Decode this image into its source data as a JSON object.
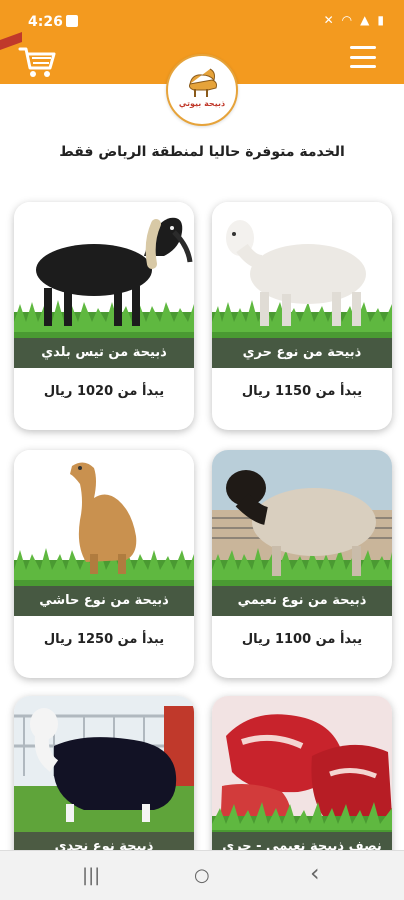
{
  "status": {
    "time": "4:26"
  },
  "app": {
    "logo_text": "ذبيحة بيوتي"
  },
  "notice": "الخدمة متوفرة حاليا لمنطقة الرياض فقط",
  "products": [
    {
      "title": "ذبيحة من نوع حري",
      "price": "يبدأ من  1150 ريال"
    },
    {
      "title": "ذبيحة من تيس بلدي",
      "price": "يبدأ من  1020 ريال"
    },
    {
      "title": "ذبيحة من نوع نعيمي",
      "price": "يبدأ من  1100 ريال"
    },
    {
      "title": "ذبيحة من نوع حاشي",
      "price": "يبدأ من  1250 ريال"
    },
    {
      "title": "نصف ذبيحة نعيمي - حري",
      "price": ""
    },
    {
      "title": "ذبيحة نوع نجدي",
      "price": ""
    }
  ],
  "nav": {
    "recents": "|||",
    "home": "○",
    "back": "‹"
  }
}
